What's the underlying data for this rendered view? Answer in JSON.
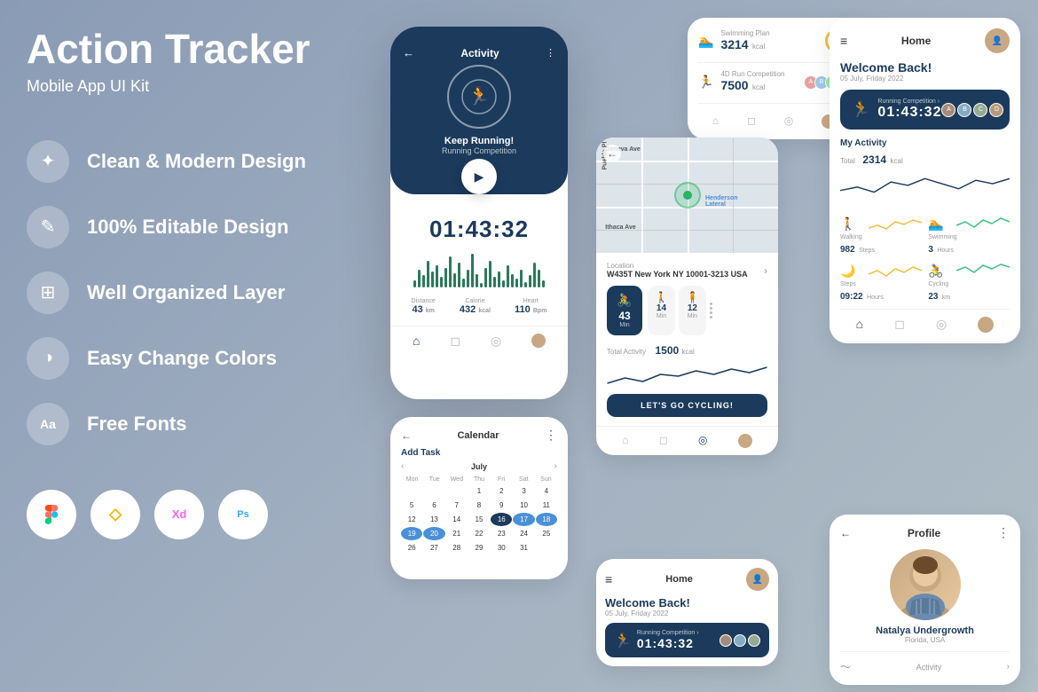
{
  "app": {
    "title": "Action Tracker",
    "subtitle": "Mobile App UI Kit"
  },
  "features": [
    {
      "id": "clean-design",
      "icon": "✦",
      "label": "Clean & Modern Design"
    },
    {
      "id": "editable",
      "icon": "✎",
      "label": "100% Editable Design"
    },
    {
      "id": "layers",
      "icon": "⊞",
      "label": "Well Organized Layer"
    },
    {
      "id": "colors",
      "icon": "◑",
      "label": "Easy Change Colors"
    },
    {
      "id": "fonts",
      "icon": "Aa",
      "label": "Free Fonts"
    }
  ],
  "tools": [
    {
      "id": "figma",
      "symbol": "F"
    },
    {
      "id": "sketch",
      "symbol": "S"
    },
    {
      "id": "xd",
      "symbol": "Xd"
    },
    {
      "id": "ps",
      "symbol": "Ps"
    }
  ],
  "phone_main": {
    "header": {
      "title": "Activity",
      "back": "←",
      "menu": "⋮"
    },
    "hero_label": "Keep Running!",
    "hero_sublabel": "Running Competition",
    "timer": "01:43:32",
    "stats": [
      {
        "label": "Distance",
        "value": "43",
        "unit": "km"
      },
      {
        "label": "Calorie",
        "value": "432",
        "unit": "kcal"
      },
      {
        "label": "Heart",
        "value": "110",
        "unit": "Bpm"
      }
    ]
  },
  "card_activity": {
    "swimming": {
      "icon": "🏊",
      "name": "Swimming Plan",
      "value": "3214",
      "unit": "kcal",
      "progress": "55%"
    },
    "running": {
      "icon": "🏃",
      "name": "4D Run Competition",
      "value": "7500",
      "unit": "kcal"
    }
  },
  "card_map": {
    "back": "←",
    "location_label": "Location",
    "location_value": "W435T New York NY 10001-3213 USA",
    "stats": [
      {
        "icon": "🚴",
        "value": "43",
        "unit": "Min"
      },
      {
        "icon": "🚶",
        "value": "14",
        "unit": "Min"
      },
      {
        "icon": "🧍",
        "value": "12",
        "unit": "Min"
      }
    ],
    "total_label": "Total Activity",
    "total_value": "1500",
    "total_unit": "kcal",
    "button": "LET'S GO CYCLING!"
  },
  "card_home_right": {
    "header": {
      "menu": "≡",
      "title": "Home"
    },
    "welcome": "Welcome Back!",
    "date": "05 July, Friday 2022",
    "running_label": "Running Competition >",
    "timer": "01:43:32",
    "my_activity": "My Activity",
    "total_label": "Total",
    "total_value": "2314",
    "total_unit": "kcal",
    "activities": [
      {
        "icon": "🚶",
        "label": "Walking",
        "value": "982",
        "unit": "Steps",
        "color": "#f0c040"
      },
      {
        "icon": "🏊",
        "label": "Swimming",
        "value": "3",
        "unit": "Hours",
        "color": "#40c080"
      },
      {
        "icon": "🌙",
        "label": "Steps",
        "value": "09:22",
        "unit": "Hours",
        "color": "#f0c040"
      },
      {
        "icon": "🚴",
        "label": "Cycling",
        "value": "23",
        "unit": "km",
        "color": "#40c080"
      }
    ]
  },
  "card_calendar": {
    "back": "←",
    "title": "Calendar",
    "menu": "⋮",
    "add_task": "Add Task",
    "month": "July",
    "days": [
      "Mon",
      "Tue",
      "Wed",
      "Thu",
      "Fri",
      "Sat",
      "Sun"
    ],
    "dates": [
      [
        "",
        "",
        "",
        "1",
        "2",
        "3",
        "4"
      ],
      [
        "5",
        "6",
        "7",
        "8",
        "9",
        "10",
        "11"
      ],
      [
        "12",
        "13",
        "14",
        "15",
        "16",
        "17",
        "18"
      ],
      [
        "19",
        "20",
        "21",
        "22",
        "23",
        "24",
        "25"
      ],
      [
        "26",
        "27",
        "28",
        "29",
        "30",
        "31",
        ""
      ]
    ],
    "today": "16",
    "highlights": [
      "17",
      "18",
      "19",
      "20"
    ]
  },
  "card_home_bottom": {
    "header": {
      "menu": "≡",
      "title": "Home"
    },
    "welcome": "Welcome Back!",
    "date": "05 July, Friday 2022",
    "running_label": "Running Competition >",
    "timer": "01:43:32"
  },
  "card_profile": {
    "back": "←",
    "title": "Profile",
    "menu": "⋮",
    "name": "Natalya Undergrowth",
    "location": "Florida, USA",
    "activity_label": "Activity"
  }
}
